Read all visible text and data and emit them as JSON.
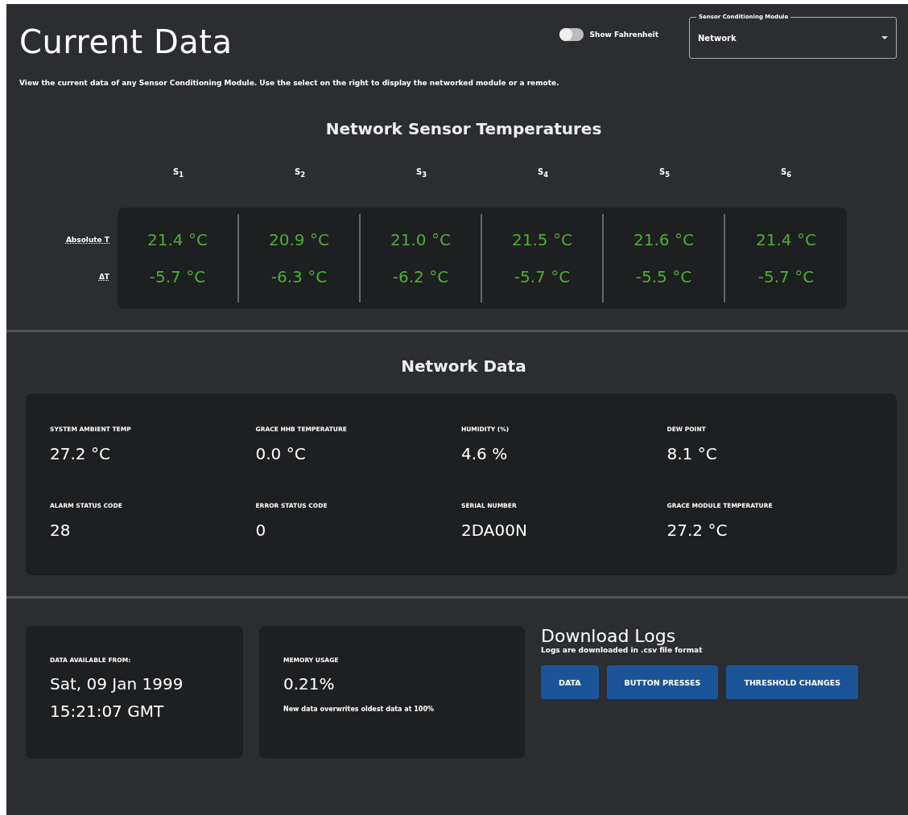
{
  "header": {
    "title": "Current Data",
    "toggle": {
      "label": "Show Fahrenheit",
      "on": false
    },
    "select": {
      "label": "Sensor Conditioning Module",
      "value": "Network"
    },
    "description": "View the current data of any Sensor Conditioning Module. Use the select on the right to display the networked module or a remote."
  },
  "temperatures": {
    "title": "Network Sensor Temperatures",
    "sensors": [
      "S$_{1}$",
      "S$_{2}$",
      "S$_{3}$",
      "S$_{4}$",
      "S$_{5}$",
      "S$_{6}$"
    ],
    "rows": [
      {
        "label": "Absolute T",
        "values": [
          "21.4 °C",
          "20.9 °C",
          "21.0 °C",
          "21.5 °C",
          "21.6 °C",
          "21.4 °C"
        ]
      },
      {
        "label": "ΔT",
        "values": [
          "-5.7 °C",
          "-6.3 °C",
          "-6.2 °C",
          "-5.7 °C",
          "-5.5 °C",
          "-5.7 °C"
        ]
      }
    ]
  },
  "network_data": {
    "title": "Network Data",
    "items": [
      {
        "label": "SYSTEM AMBIENT TEMP",
        "value": "27.2 °C"
      },
      {
        "label": "GRACE HHB TEMPERATURE",
        "value": "0.0 °C"
      },
      {
        "label": "HUMIDITY (%)",
        "value": "4.6 %"
      },
      {
        "label": "DEW POINT",
        "value": "8.1 °C"
      },
      {
        "label": "ALARM STATUS CODE",
        "value": "28"
      },
      {
        "label": "ERROR STATUS CODE",
        "value": "0"
      },
      {
        "label": "SERIAL NUMBER",
        "value": "2DA00N"
      },
      {
        "label": "GRACE MODULE TEMPERATURE",
        "value": "27.2 °C"
      }
    ]
  },
  "data_available": {
    "label": "DATA AVAILABLE FROM:",
    "lines": [
      "Sat, 09 Jan 1999",
      "15:21:07 GMT"
    ]
  },
  "memory": {
    "label": "MEMORY USAGE",
    "value": "0.21%",
    "note": "New data overwrites oldest data at 100%"
  },
  "download": {
    "title": "Download Logs",
    "subtitle": "Logs are downloaded in .csv file format",
    "buttons": [
      "DATA",
      "BUTTON PRESSES",
      "THRESHOLD CHANGES"
    ]
  }
}
